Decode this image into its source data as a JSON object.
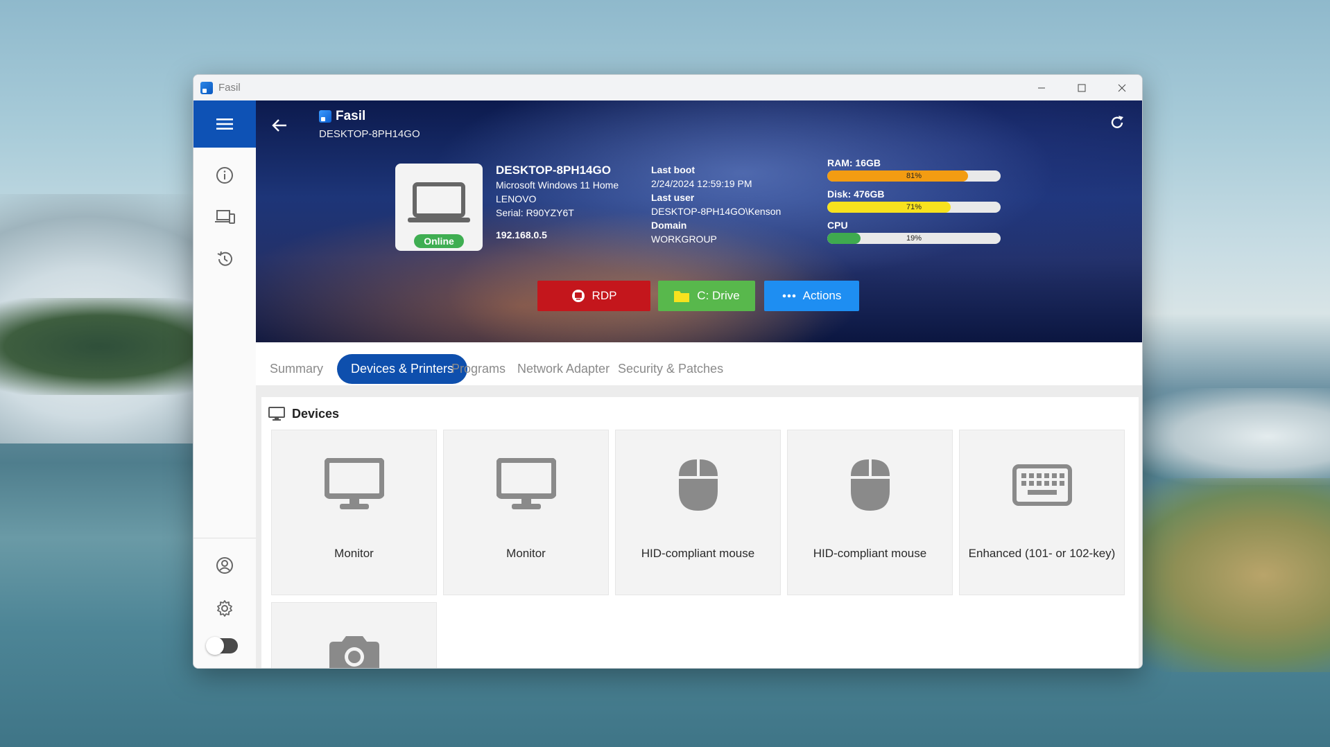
{
  "window": {
    "title": "Fasil"
  },
  "header": {
    "app_name": "Fasil",
    "hostname": "DESKTOP-8PH14GO",
    "status": "Online",
    "device": {
      "name": "DESKTOP-8PH14GO",
      "os": "Microsoft Windows 11 Home",
      "manufacturer": "LENOVO",
      "serial": "Serial: R90YZY6T",
      "ip": "192.168.0.5"
    },
    "details": {
      "last_boot_label": "Last boot",
      "last_boot": "2/24/2024 12:59:19 PM",
      "last_user_label": "Last user",
      "last_user": "DESKTOP-8PH14GO\\Kenson",
      "domain_label": "Domain",
      "domain": "WORKGROUP"
    },
    "meters": {
      "ram": {
        "label": "RAM: 16GB",
        "percent": 81,
        "text": "81%",
        "color": "#f39c12"
      },
      "disk": {
        "label": "Disk: 476GB",
        "percent": 71,
        "text": "71%",
        "color": "#f7e21e"
      },
      "cpu": {
        "label": "CPU",
        "percent": 19,
        "text": "19%",
        "color": "#3faa4f"
      }
    },
    "buttons": {
      "rdp": "RDP",
      "drive": "C: Drive",
      "actions": "Actions"
    }
  },
  "tabs": [
    "Summary",
    "Devices & Printers",
    "Programs",
    "Network Adapter",
    "Security & Patches"
  ],
  "active_tab": "Devices & Printers",
  "devices_section": {
    "title": "Devices",
    "items": [
      "Monitor",
      "Monitor",
      "HID-compliant mouse",
      "HID-compliant mouse",
      "Enhanced (101- or 102-key)",
      ""
    ]
  },
  "colors": {
    "accent": "#0e52b5",
    "rdp": "#c4161c",
    "drive": "#58b84c",
    "actions": "#1e8ef2"
  },
  "icons": [
    "hamburger-icon",
    "info-icon",
    "devices-icon",
    "history-icon",
    "account-icon",
    "gear-icon",
    "back-arrow-icon",
    "refresh-icon",
    "laptop-icon",
    "monitor-icon",
    "mouse-icon",
    "keyboard-icon",
    "camera-icon",
    "folder-icon"
  ]
}
